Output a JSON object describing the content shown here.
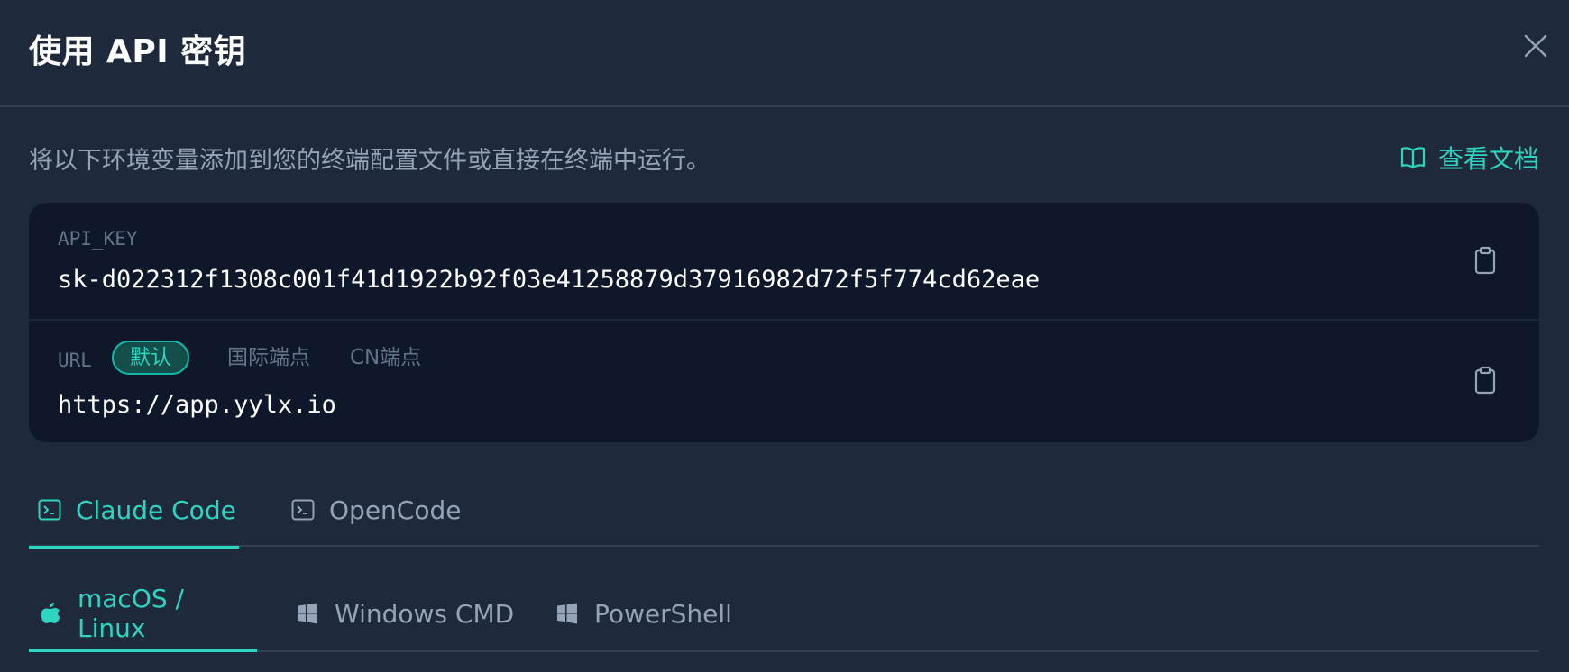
{
  "dialog": {
    "title": "使用 API 密钥",
    "description": "将以下环境变量添加到您的终端配置文件或直接在终端中运行。",
    "docs_link": "查看文档"
  },
  "api_key": {
    "label": "API_KEY",
    "value": "sk-d022312f1308c001f41d1922b92f03e41258879d37916982d72f5f774cd62eae"
  },
  "url": {
    "label": "URL",
    "endpoints": [
      "默认",
      "国际端点",
      "CN端点"
    ],
    "active_endpoint": "默认",
    "value": "https://app.yylx.io"
  },
  "tool_tabs": [
    {
      "label": "Claude Code",
      "icon": "terminal-icon",
      "active": true
    },
    {
      "label": "OpenCode",
      "icon": "terminal-icon",
      "active": false
    }
  ],
  "os_tabs": [
    {
      "label": "macOS / Linux",
      "icon": "apple-icon",
      "active": true
    },
    {
      "label": "Windows CMD",
      "icon": "windows-icon",
      "active": false
    },
    {
      "label": "PowerShell",
      "icon": "windows-icon",
      "active": false
    }
  ],
  "colors": {
    "background": "#1e293b",
    "card": "#0f172a",
    "accent": "#2dd4bf",
    "muted": "#94a3b8"
  }
}
